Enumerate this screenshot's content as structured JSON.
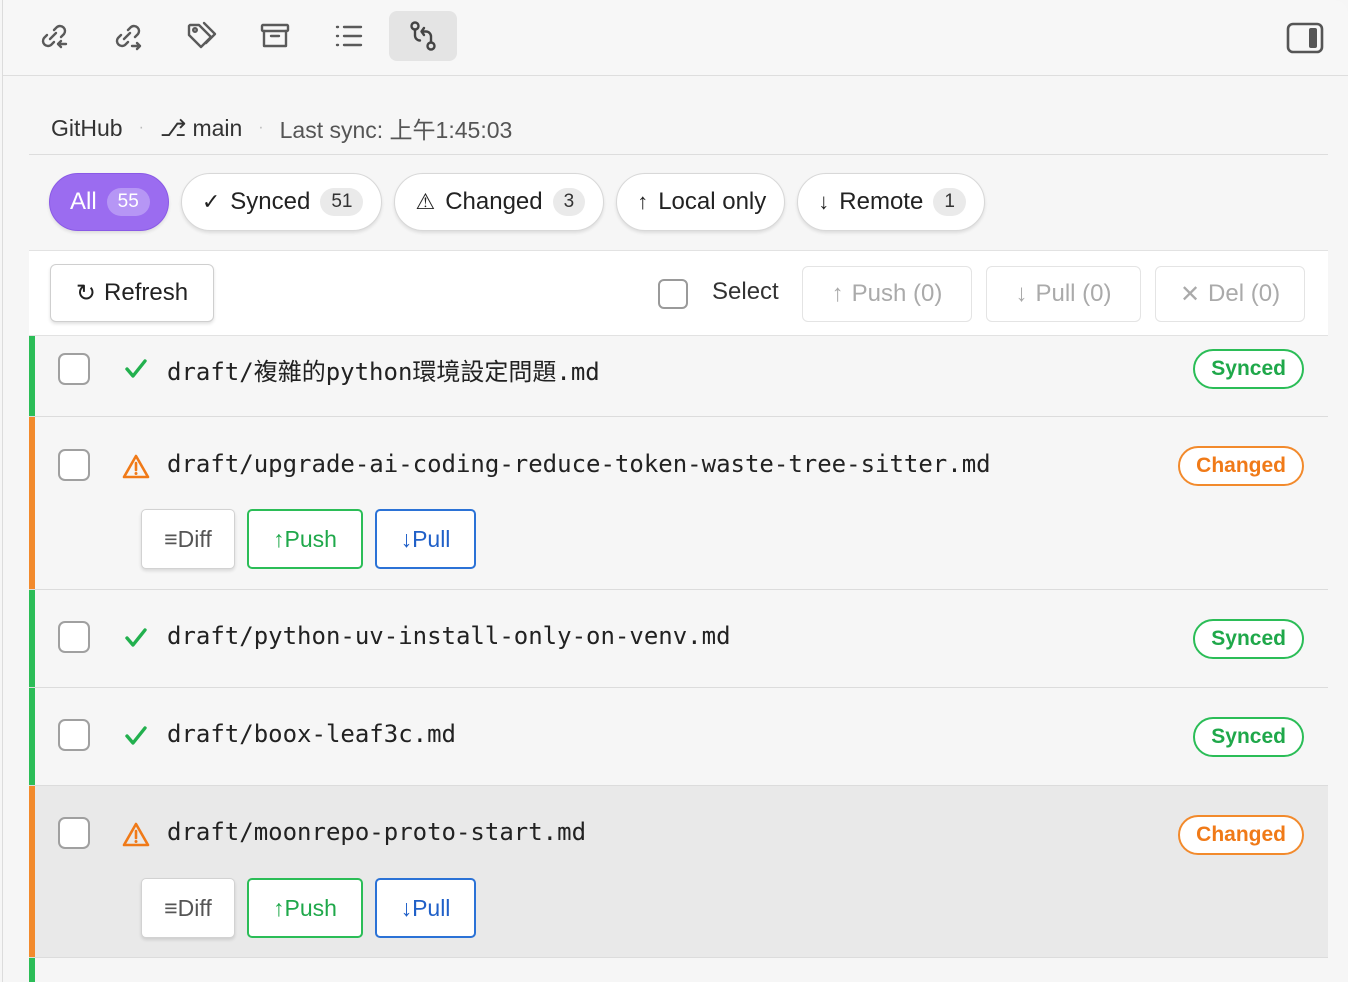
{
  "toolbar": {
    "icons": [
      "link-in-icon",
      "link-out-icon",
      "tags-icon",
      "archive-icon",
      "list-icon",
      "git-compare-icon"
    ],
    "active": "git-compare-icon"
  },
  "meta": {
    "provider": "GitHub",
    "branch_glyph": "⎇",
    "branch": "main",
    "separator": "·",
    "last_sync": "Last sync: 上午1:45:03"
  },
  "filters": [
    {
      "glyph": "",
      "label": "All",
      "count": "55"
    },
    {
      "glyph": "✓",
      "label": "Synced",
      "count": "51"
    },
    {
      "glyph": "⚠",
      "label": "Changed",
      "count": "3"
    },
    {
      "glyph": "↑",
      "label": "Local only",
      "count": ""
    },
    {
      "glyph": "↓",
      "label": "Remote",
      "count": "1"
    }
  ],
  "actions": {
    "refresh_glyph": "↻",
    "refresh": "Refresh",
    "select": "Select",
    "push_glyph": "↑",
    "push": "Push (0)",
    "pull_glyph": "↓",
    "pull": "Pull (0)",
    "del_glyph": "✕",
    "del": "Del (0)"
  },
  "row_buttons": {
    "diff": "≡Diff",
    "push": "↑Push",
    "pull": "↓Pull"
  },
  "files": [
    {
      "name": "draft/複雜的python環境設定問題.md",
      "status": "Synced"
    },
    {
      "name": "draft/upgrade-ai-coding-reduce-token-waste-tree-sitter.md",
      "status": "Changed"
    },
    {
      "name": "draft/python-uv-install-only-on-venv.md",
      "status": "Synced"
    },
    {
      "name": "draft/boox-leaf3c.md",
      "status": "Synced"
    },
    {
      "name": "draft/moonrepo-proto-start.md",
      "status": "Changed"
    }
  ],
  "colors": {
    "accent": "#9b6cf0",
    "synced": "#2bbd57",
    "changed": "#f28a2c",
    "pull": "#2b72d6"
  }
}
